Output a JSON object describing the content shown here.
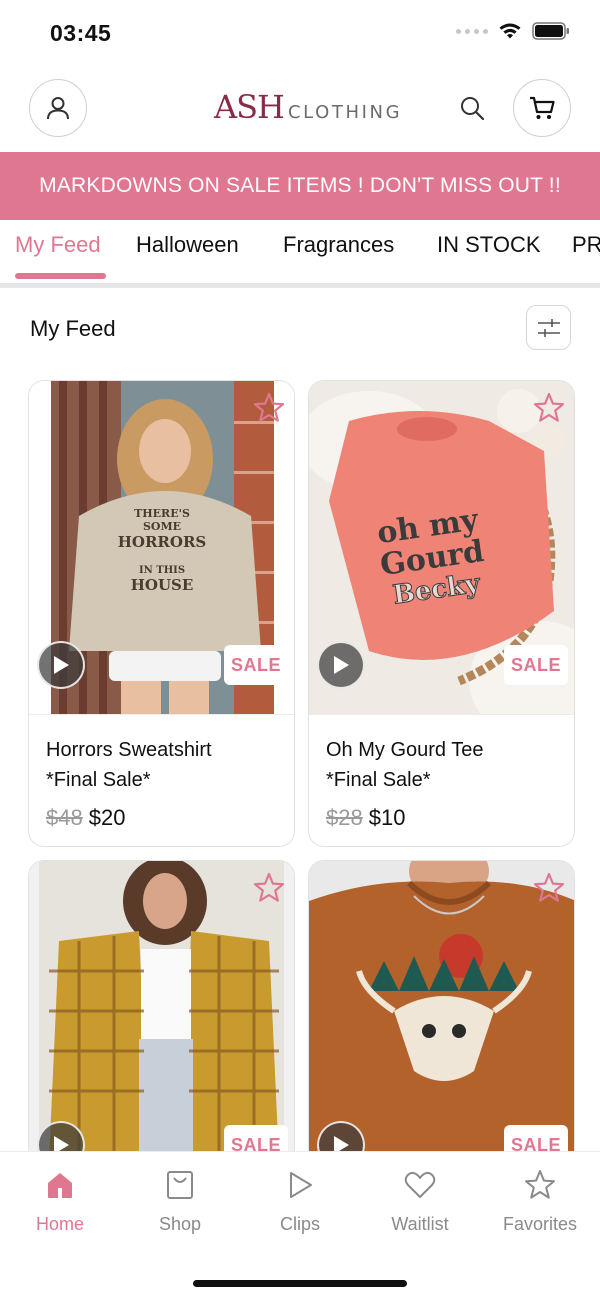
{
  "status_bar": {
    "time": "03:45"
  },
  "header": {
    "logo_main": "ASH",
    "logo_sub": "CLOTHING",
    "profile_icon": "person-icon",
    "search_icon": "search-icon",
    "cart_icon": "cart-icon"
  },
  "banner": {
    "text": "MARKDOWNS ON SALE ITEMS ! DON'T MISS OUT !!"
  },
  "tabs": [
    {
      "label": "My Feed",
      "active": true
    },
    {
      "label": "Halloween"
    },
    {
      "label": "Fragrances"
    },
    {
      "label": "IN STOCK"
    },
    {
      "label": "PR"
    }
  ],
  "feed": {
    "title": "My Feed",
    "filter_icon": "sliders-icon"
  },
  "products": [
    {
      "name_line1": "Horrors Sweatshirt",
      "name_line2": "*Final Sale*",
      "old_price": "$48",
      "price": "$20",
      "badge": "SALE",
      "image_print": [
        "THERE'S SOME",
        "HORRORS",
        "IN THIS",
        "HOUSE"
      ]
    },
    {
      "name_line1": "Oh My Gourd Tee",
      "name_line2": "*Final Sale*",
      "old_price": "$28",
      "price": "$10",
      "badge": "SALE",
      "image_print": [
        "oh my",
        "Gourd",
        "Becky"
      ]
    },
    {
      "badge": "SALE"
    },
    {
      "badge": "SALE"
    }
  ],
  "tabbar": [
    {
      "label": "Home",
      "icon": "home-icon",
      "active": true
    },
    {
      "label": "Shop",
      "icon": "shopping-bag-icon"
    },
    {
      "label": "Clips",
      "icon": "play-icon"
    },
    {
      "label": "Waitlist",
      "icon": "heart-icon"
    },
    {
      "label": "Favorites",
      "icon": "star-icon"
    }
  ],
  "colors": {
    "accent": "#e07791",
    "logo": "#8a2a45"
  }
}
